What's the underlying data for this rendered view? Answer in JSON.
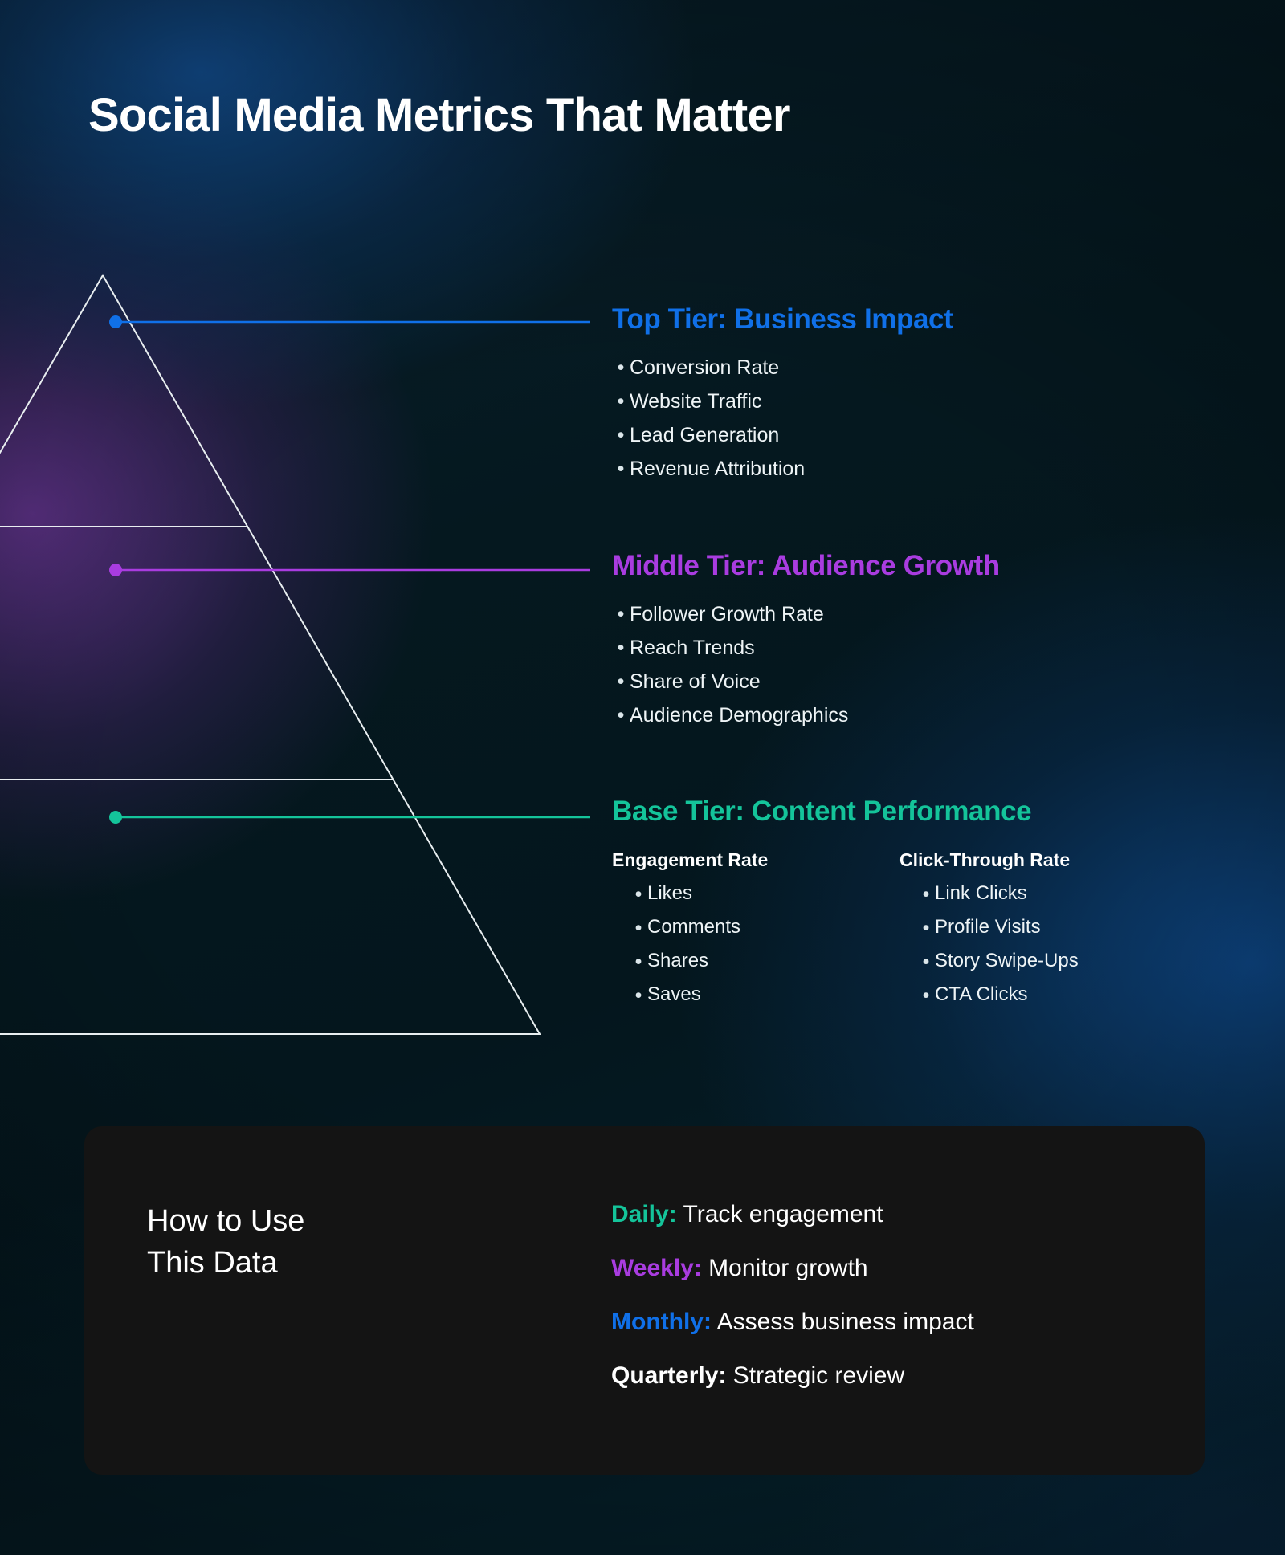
{
  "header": {
    "title": "Social Media Metrics That Matter"
  },
  "colors": {
    "top_tier": "#1070e8",
    "middle_tier": "#a93ce0",
    "base_tier": "#14c49a",
    "quarterly": "#ffffff",
    "pyramid_stroke": "#e8eef0",
    "card_bg": "#141414",
    "page_bg": "#06202b"
  },
  "pyramid": {
    "name": "metrics-pyramid",
    "tiers": [
      "top",
      "middle",
      "base"
    ]
  },
  "tiers": [
    {
      "id": "top",
      "heading": "Top Tier: Business Impact",
      "color": "#1070e8",
      "items": [
        "Conversion Rate",
        "Website Traffic",
        "Lead Generation",
        "Revenue Attribution"
      ]
    },
    {
      "id": "middle",
      "heading": "Middle Tier: Audience Growth",
      "color": "#a93ce0",
      "items": [
        "Follower Growth Rate",
        "Reach Trends",
        "Share of Voice",
        "Audience Demographics"
      ]
    },
    {
      "id": "base",
      "heading": "Base Tier: Content Performance",
      "color": "#14c49a",
      "columns": [
        {
          "title": "Engagement Rate",
          "items": [
            "Likes",
            "Comments",
            "Shares",
            "Saves"
          ]
        },
        {
          "title": "Click-Through Rate",
          "items": [
            "Link Clicks",
            "Profile Visits",
            "Story Swipe-Ups",
            "CTA Clicks"
          ]
        }
      ]
    }
  ],
  "bullet_glyph": "•",
  "usage": {
    "title_line1": "How to Use",
    "title_line2": "This Data",
    "rows": [
      {
        "label": "Daily:",
        "text": " Track engagement",
        "color": "#14c49a"
      },
      {
        "label": "Weekly:",
        "text": " Monitor growth",
        "color": "#a93ce0"
      },
      {
        "label": "Monthly:",
        "text": " Assess business impact",
        "color": "#1070e8"
      },
      {
        "label": "Quarterly:",
        "text": " Strategic review",
        "color": "#ffffff"
      }
    ]
  }
}
